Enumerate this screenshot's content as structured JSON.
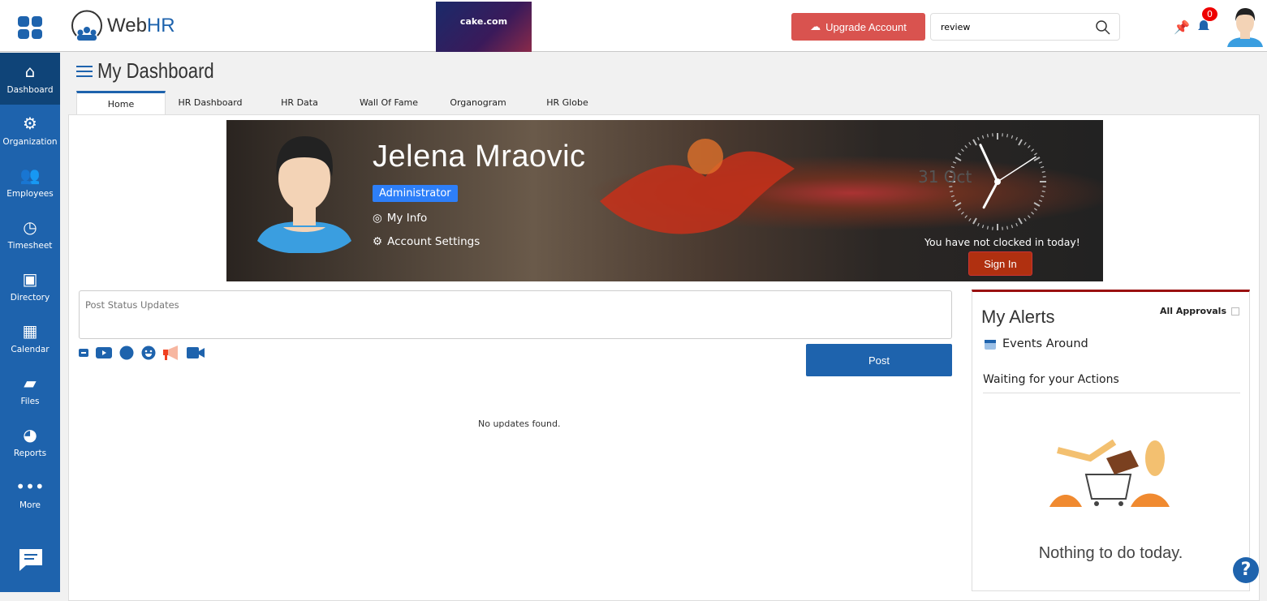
{
  "header": {
    "brand": "WebHR",
    "brand_accent": "HR",
    "brand_prefix": "Web",
    "ad_text": "cake.com",
    "upgrade_label": "Upgrade Account",
    "search_value": "review",
    "notification_count": "0"
  },
  "sidebar": {
    "items": [
      {
        "label": "Dashboard",
        "icon": "home-icon"
      },
      {
        "label": "Organization",
        "icon": "gear-icon"
      },
      {
        "label": "Employees",
        "icon": "users-icon"
      },
      {
        "label": "Timesheet",
        "icon": "clock-icon"
      },
      {
        "label": "Directory",
        "icon": "id-card-icon"
      },
      {
        "label": "Calendar",
        "icon": "calendar-icon"
      },
      {
        "label": "Files",
        "icon": "folder-icon"
      },
      {
        "label": "Reports",
        "icon": "pie-chart-icon"
      },
      {
        "label": "More",
        "icon": "more-icon"
      }
    ],
    "active": "Dashboard"
  },
  "page": {
    "title": "My Dashboard",
    "tabs": [
      "Home",
      "HR Dashboard",
      "HR Data",
      "Wall Of Fame",
      "Organogram",
      "HR Globe"
    ],
    "active_tab": "Home"
  },
  "profile": {
    "name": "Jelena Mraovic",
    "role": "Administrator",
    "my_info": "My Info",
    "account_settings": "Account Settings",
    "clock_date": "31 Oct",
    "clock_message": "You have not clocked in today!",
    "sign_in": "Sign In"
  },
  "feed": {
    "placeholder": "Post Status Updates",
    "post_label": "Post",
    "empty": "No updates found."
  },
  "alerts": {
    "title": "My Alerts",
    "all_approvals": "All Approvals",
    "events": "Events Around",
    "waiting": "Waiting for your Actions",
    "nothing": "Nothing to do today."
  },
  "colors": {
    "primary": "#1e63ad",
    "upgrade": "#d9534f",
    "sign_in": "#b03010",
    "alerts_border": "#9a1010"
  }
}
